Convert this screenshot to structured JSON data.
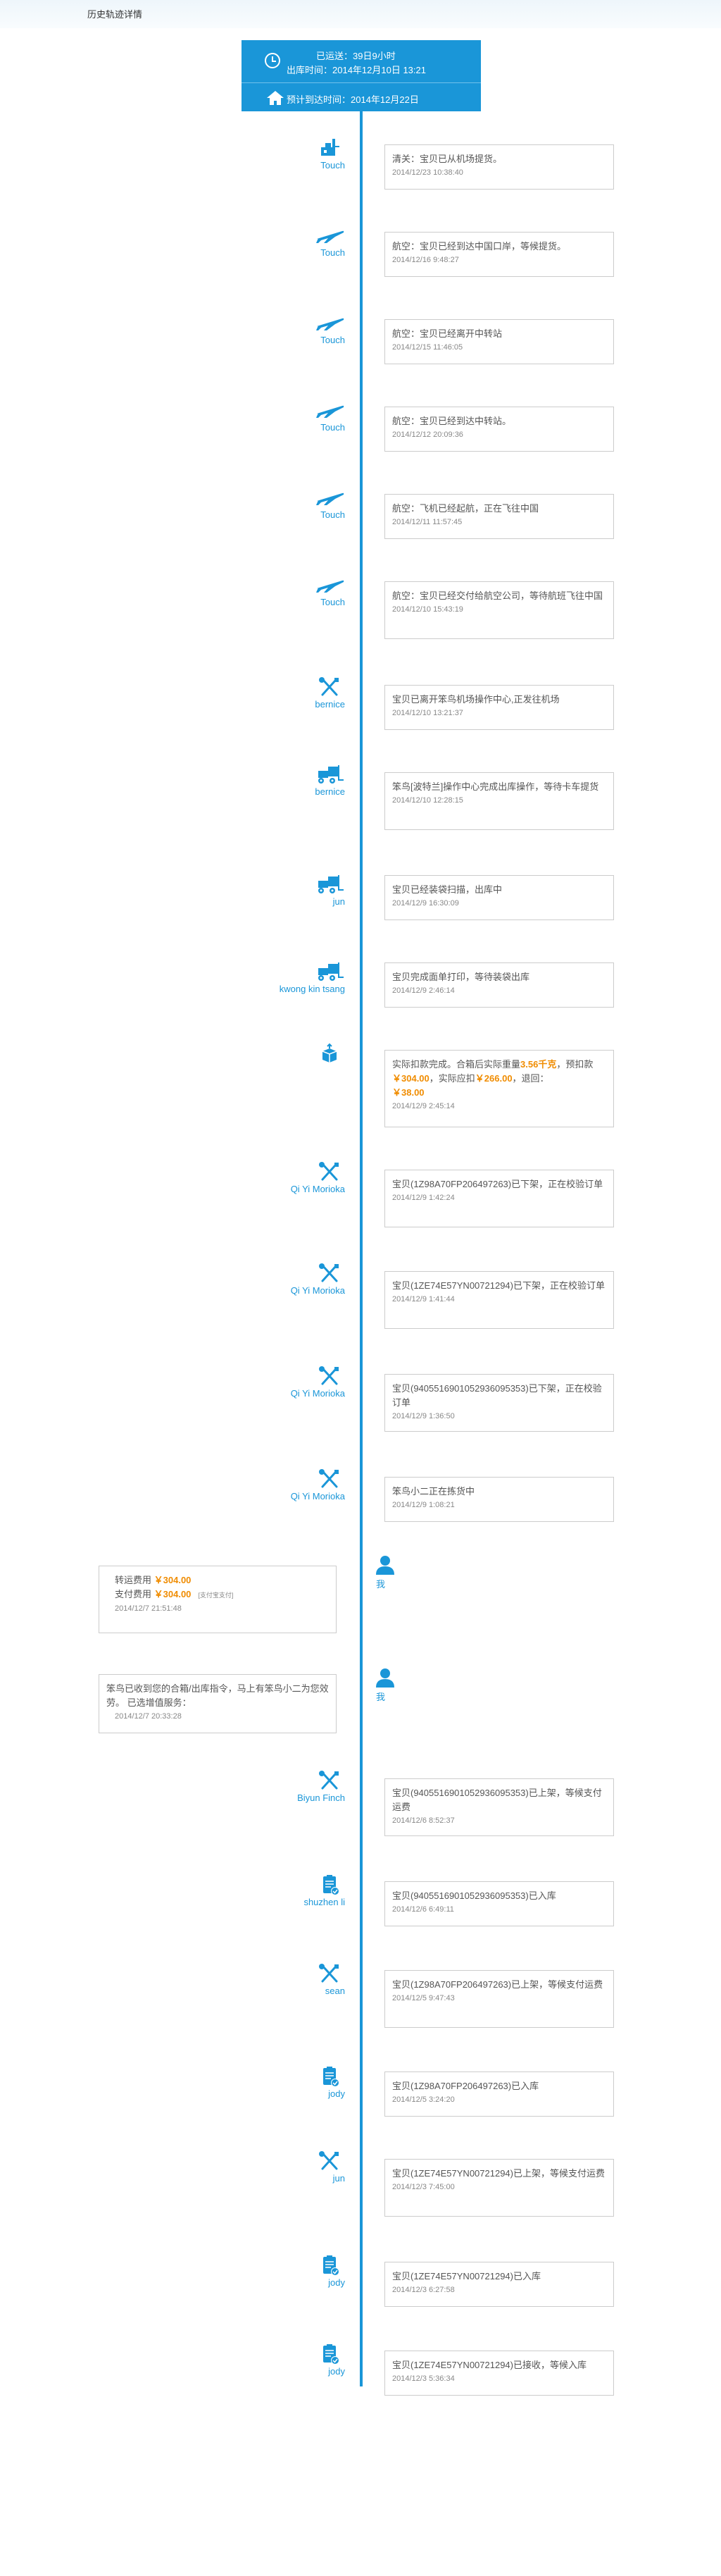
{
  "page_title": "历史轨迹详情",
  "header": {
    "line1": "已运送：39日9小时",
    "line2": "出库时间：2014年12月10日 13:21",
    "line3": "预计到达时间：2014年12月22日"
  },
  "events": [
    {
      "name": "Touch",
      "icon": "customs-stamp-icon",
      "text": "清关：宝贝已从机场提货。",
      "time": "2014/12/23 10:38:40"
    },
    {
      "name": "Touch",
      "icon": "airplane-icon",
      "text": "航空：宝贝已经到达中国口岸，等候提货。",
      "time": "2014/12/16 9:48:27"
    },
    {
      "name": "Touch",
      "icon": "airplane-icon",
      "text": "航空：宝贝已经离开中转站",
      "time": "2014/12/15 11:46:05"
    },
    {
      "name": "Touch",
      "icon": "airplane-icon",
      "text": "航空：宝贝已经到达中转站。",
      "time": "2014/12/12 20:09:36"
    },
    {
      "name": "Touch",
      "icon": "airplane-icon",
      "text": "航空：飞机已经起航，正在飞往中国",
      "time": "2014/12/11 11:57:45"
    },
    {
      "name": "Touch",
      "icon": "airplane-icon",
      "text": "航空：宝贝已经交付给航空公司，等待航班飞往中国",
      "time": "2014/12/10 15:43:19"
    },
    {
      "name": "bernice",
      "icon": "tools-icon",
      "text": "宝贝已离开笨鸟机场操作中心,正发往机场",
      "time": "2014/12/10 13:21:37"
    },
    {
      "name": "bernice",
      "icon": "forklift-icon",
      "text": "笨鸟[波特兰]操作中心完成出库操作，等待卡车提货",
      "time": "2014/12/10 12:28:15"
    },
    {
      "name": "jun",
      "icon": "forklift-icon",
      "text": "宝贝已经装袋扫描，出库中",
      "time": "2014/12/9 16:30:09"
    },
    {
      "name": "kwong kin tsang",
      "icon": "forklift-icon",
      "text": "宝贝完成面单打印，等待装袋出库",
      "time": "2014/12/9 2:46:14"
    },
    {
      "name": "",
      "icon": "package-icon",
      "text": "",
      "time": "2014/12/9 2:45:14"
    },
    {
      "name": "Qi Yi Morioka",
      "icon": "tools-icon",
      "text": "宝贝(1Z98A70FP206497263)已下架，正在校验订单",
      "time": "2014/12/9 1:42:24"
    },
    {
      "name": "Qi Yi Morioka",
      "icon": "tools-icon",
      "text": "宝贝(1ZE74E57YN00721294)已下架，正在校验订单",
      "time": "2014/12/9 1:41:44"
    },
    {
      "name": "Qi Yi Morioka",
      "icon": "tools-icon",
      "text": "宝贝(9405516901052936095353)已下架，正在校验订单",
      "time": "2014/12/9 1:36:50"
    },
    {
      "name": "Qi Yi Morioka",
      "icon": "tools-icon",
      "text": "笨鸟小二正在拣货中",
      "time": "2014/12/9 1:08:21"
    },
    {
      "name": "我",
      "icon": "user-icon",
      "text": "",
      "time": "2014/12/7 21:51:48"
    },
    {
      "name": "我",
      "icon": "user-icon",
      "text": "笨鸟已收到您的合箱/出库指令，马上有笨鸟小二为您效劳。 已选增值服务：",
      "time": "2014/12/7 20:33:28"
    },
    {
      "name": "Biyun Finch",
      "icon": "tools-icon",
      "text": "宝贝(9405516901052936095353)已上架，等候支付运费",
      "time": "2014/12/6 8:52:37"
    },
    {
      "name": "shuzhen li",
      "icon": "clipboard-check-icon",
      "text": "宝贝(9405516901052936095353)已入库",
      "time": "2014/12/6 6:49:11"
    },
    {
      "name": "sean",
      "icon": "tools-icon",
      "text": "宝贝(1Z98A70FP206497263)已上架，等候支付运费",
      "time": "2014/12/5 9:47:43"
    },
    {
      "name": "jody",
      "icon": "clipboard-check-icon",
      "text": "宝贝(1Z98A70FP206497263)已入库",
      "time": "2014/12/5 3:24:20"
    },
    {
      "name": "jun",
      "icon": "tools-icon",
      "text": "宝贝(1ZE74E57YN00721294)已上架，等候支付运费",
      "time": "2014/12/3 7:45:00"
    },
    {
      "name": "jody",
      "icon": "clipboard-check-icon",
      "text": "宝贝(1ZE74E57YN00721294)已入库",
      "time": "2014/12/3 6:27:58"
    },
    {
      "name": "jody",
      "icon": "clipboard-check-icon",
      "text": "宝贝(1ZE74E57YN00721294)已接收，等候入库",
      "time": "2014/12/3 5:36:34"
    }
  ],
  "weigh": {
    "p1": "实际扣款完成。合箱后实际重量",
    "weight": "3.56千克",
    "p2": "，预扣款",
    "prepay": "￥304.00",
    "p3": "，实际应扣",
    "actual": "￥266.00",
    "p4": "，退回：",
    "refund": "￥38.00"
  },
  "fee": {
    "label1": "转运费用",
    "value1": "￥304.00",
    "label2": "支付费用",
    "value2": "￥304.00",
    "note": "[支付宝支付]"
  },
  "colors": {
    "accent": "#1a96d8",
    "highlight": "#f08c00"
  }
}
